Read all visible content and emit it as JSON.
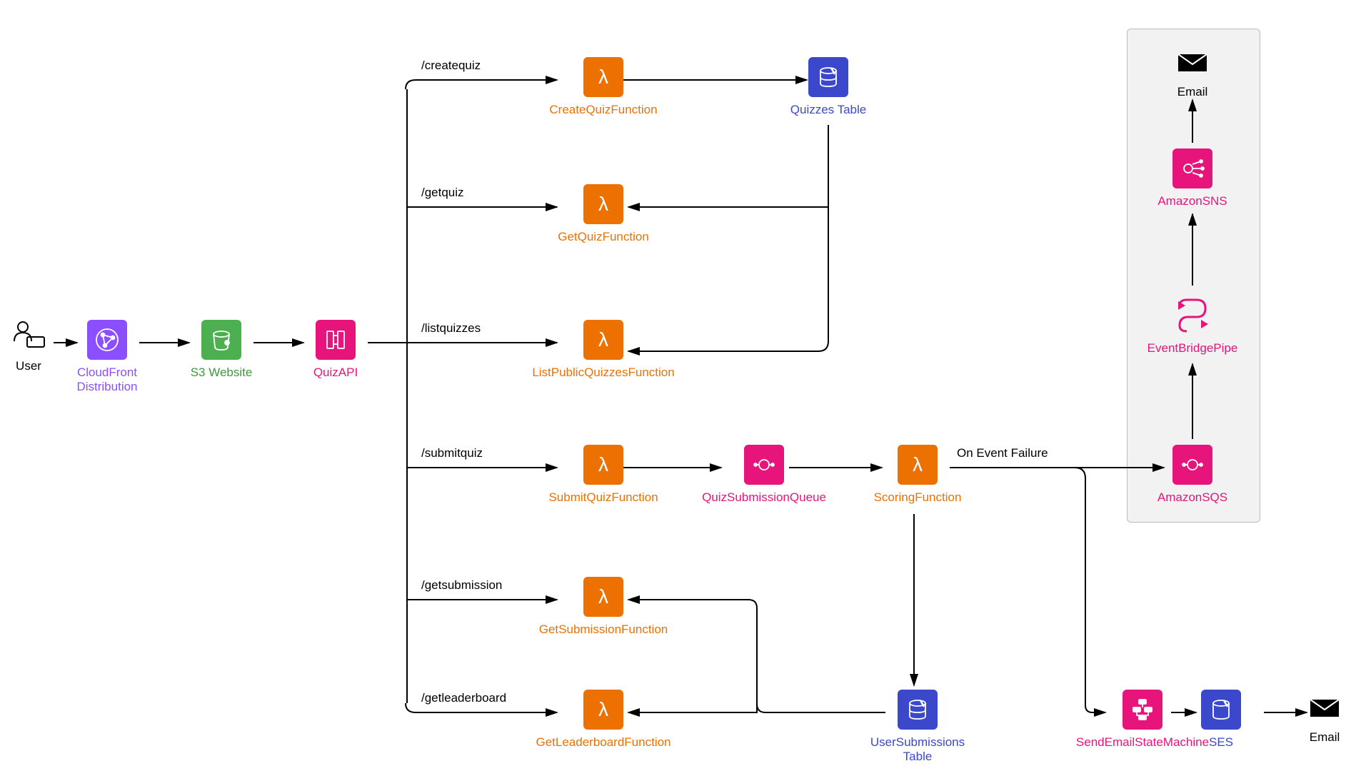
{
  "nodes": {
    "user": {
      "label": "User"
    },
    "cloudfront": {
      "label": "CloudFront\nDistribution"
    },
    "s3": {
      "label": "S3 Website"
    },
    "api": {
      "label": "QuizAPI"
    },
    "createquiz": {
      "label": "CreateQuizFunction"
    },
    "getquiz": {
      "label": "GetQuizFunction"
    },
    "listquizzes": {
      "label": "ListPublicQuizzesFunction"
    },
    "submitquiz": {
      "label": "SubmitQuizFunction"
    },
    "getsubmission": {
      "label": "GetSubmissionFunction"
    },
    "getleaderboard": {
      "label": "GetLeaderboardFunction"
    },
    "quizzestable": {
      "label": "Quizzes Table"
    },
    "submissionqueue": {
      "label": "QuizSubmissionQueue"
    },
    "scoring": {
      "label": "ScoringFunction"
    },
    "usersubtable": {
      "label": "UserSubmissions\nTable"
    },
    "sendemail": {
      "label": "SendEmailStateMachine"
    },
    "ses": {
      "label": "SES"
    },
    "email2": {
      "label": "Email"
    },
    "sqs": {
      "label": "AmazonSQS"
    },
    "pipe": {
      "label": "EventBridgePipe"
    },
    "sns": {
      "label": "AmazonSNS"
    },
    "email1": {
      "label": "Email"
    }
  },
  "edges": {
    "createquiz": "/createquiz",
    "getquiz": "/getquiz",
    "listquizzes": "/listquizzes",
    "submitquiz": "/submitquiz",
    "getsubmission": "/getsubmission",
    "getleaderboard": "/getleaderboard",
    "onfailure": "On Event Failure"
  }
}
